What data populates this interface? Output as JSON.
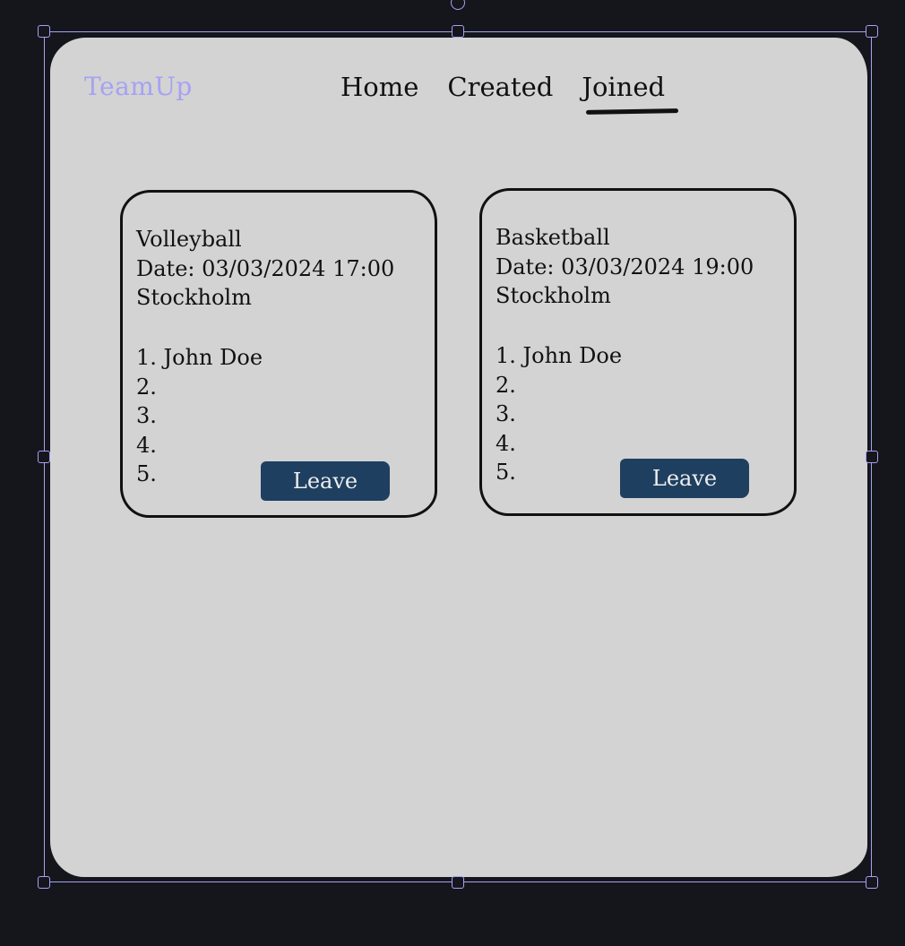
{
  "header": {
    "logo": "TeamUp",
    "nav": [
      "Home",
      "Created",
      "Joined"
    ],
    "active_nav": "Joined"
  },
  "cards": [
    {
      "sport": "Volleyball",
      "date": "Date: 03/03/2024 17:00",
      "location": "Stockholm",
      "roster": [
        "1. John Doe",
        "2.",
        "3.",
        "4.",
        "5."
      ],
      "button_label": "Leave"
    },
    {
      "sport": "Basketball",
      "date": "Date: 03/03/2024 19:00",
      "location": "Stockholm",
      "roster": [
        "1. John Doe",
        "2.",
        "3.",
        "4.",
        "5."
      ],
      "button_label": "Leave"
    }
  ],
  "colors": {
    "background": "#14161c",
    "frame": "#d3d3d3",
    "selection": "#a5a2f3",
    "logo": "#a5a2f3",
    "button": "#1e3f60",
    "button_text": "#eeeeee",
    "ink": "#111111"
  }
}
